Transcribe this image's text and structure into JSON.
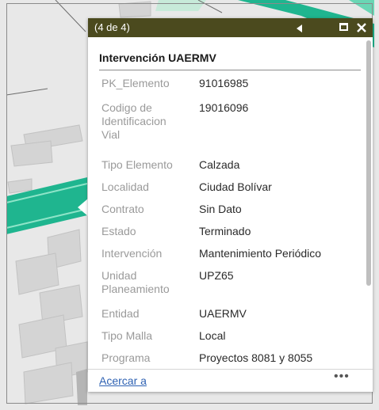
{
  "colors": {
    "title_bar": "#4b4a1e",
    "road_fill": "#1fb58f",
    "road_light": "#69d6b4",
    "link": "#2f62b3",
    "map_background": "#e6e6e6",
    "building": "#d2d2d2"
  },
  "popup": {
    "counter": "(4 de 4)",
    "header": "Intervención UAERMV",
    "attributes": [
      {
        "label": "PK_Elemento",
        "value": "91016985"
      },
      {
        "label": "Codigo de Identificacion Vial",
        "value": "19016096"
      },
      {
        "label": "Tipo Elemento",
        "value": "Calzada"
      },
      {
        "label": "Localidad",
        "value": "Ciudad Bolívar"
      },
      {
        "label": "Contrato",
        "value": "Sin Dato"
      },
      {
        "label": "Estado",
        "value": "Terminado"
      },
      {
        "label": "Intervención",
        "value": "Mantenimiento Periódico"
      },
      {
        "label": "Unidad Planeamiento",
        "value": "UPZ65"
      },
      {
        "label": "Entidad",
        "value": "UAERMV"
      },
      {
        "label": "Tipo Malla",
        "value": "Local"
      },
      {
        "label": "Programa",
        "value": "Proyectos 8081 y 8055"
      }
    ],
    "footer": {
      "zoom_link": "Acercar a",
      "more": "•••"
    }
  },
  "icons": {
    "previous": "triangle-left-icon",
    "maximize": "maximize-icon",
    "close": "close-icon",
    "more": "more-horizontal-icon"
  }
}
